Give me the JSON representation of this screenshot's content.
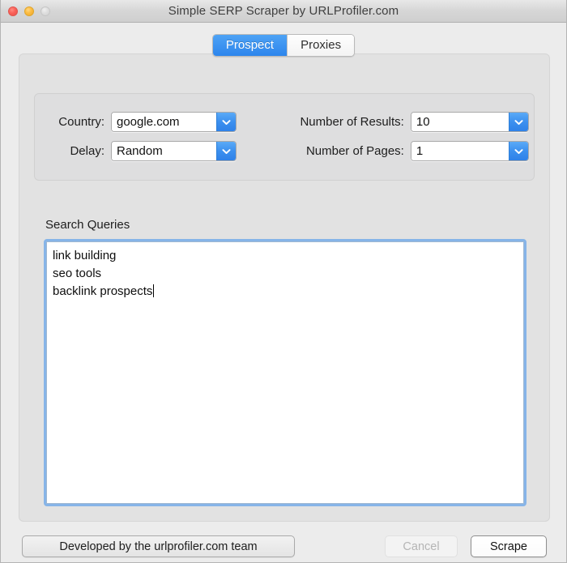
{
  "window": {
    "title": "Simple SERP Scraper by URLProfiler.com",
    "traffic_lights": {
      "close_label": "Close",
      "minimize_label": "Minimize",
      "zoom_label": "Zoom"
    }
  },
  "tabs": [
    {
      "label": "Prospect",
      "active": true
    },
    {
      "label": "Proxies",
      "active": false
    }
  ],
  "options": {
    "country": {
      "label": "Country:",
      "value": "google.com"
    },
    "delay": {
      "label": "Delay:",
      "value": "Random"
    },
    "number_of_results": {
      "label": "Number of Results:",
      "value": "10"
    },
    "number_of_pages": {
      "label": "Number of Pages:",
      "value": "1"
    }
  },
  "queries": {
    "label": "Search Queries",
    "lines": [
      "link building",
      "seo tools",
      "backlink prospects"
    ],
    "caret_after_line": 2
  },
  "footer": {
    "credit_label": "Developed by the urlprofiler.com team",
    "cancel_label": "Cancel",
    "cancel_enabled": false,
    "scrape_label": "Scrape",
    "scrape_enabled": true
  },
  "colors": {
    "accent_blue": "#2d85ec",
    "combo_arrow_blue": "#3c90ef",
    "focus_ring": "#86b4e8",
    "window_chrome": "#ececec",
    "panel": "#e2e2e2",
    "group": "#dededf",
    "close_red": "#fa6058",
    "min_yellow": "#fcbb40",
    "zoom_grey": "#dedede"
  }
}
